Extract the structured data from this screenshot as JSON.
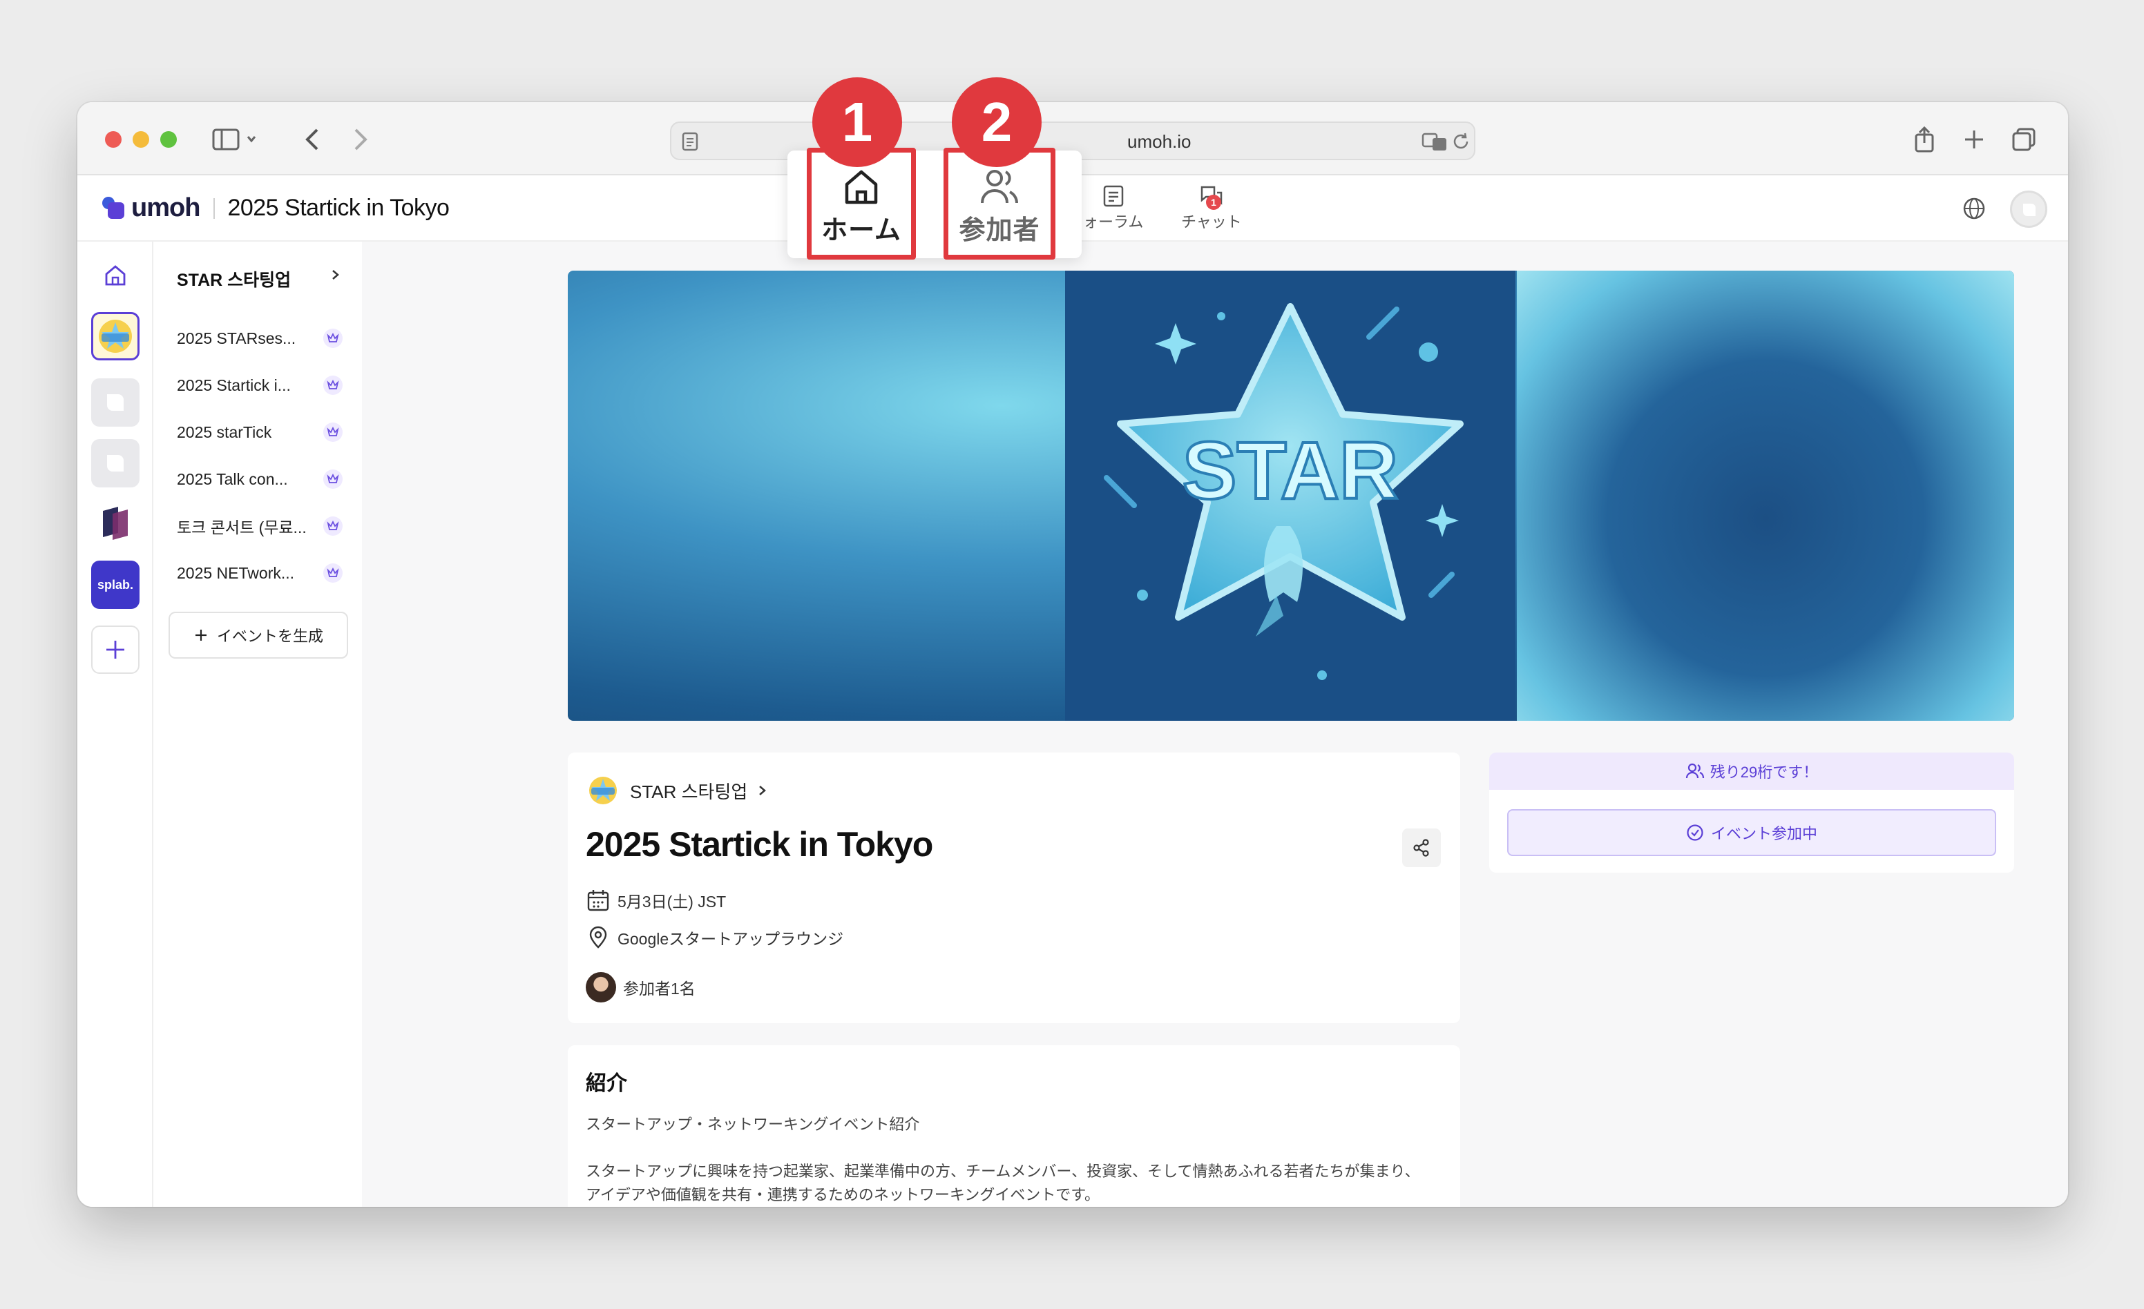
{
  "browser": {
    "url": "umoh.io"
  },
  "app": {
    "logo_text": "umoh",
    "event_title": "2025 Startick in Tokyo",
    "nav": {
      "forum_label": "ォーラム",
      "chat_label": "チャット",
      "chat_badge": "1"
    }
  },
  "annotations": {
    "home": {
      "number": "1",
      "label": "ホーム"
    },
    "participants": {
      "number": "2",
      "label": "参加者"
    }
  },
  "rail": {
    "splab_label": "splab."
  },
  "sidebar": {
    "header": "STAR 스타팅업",
    "items": [
      {
        "label": "2025 STARses..."
      },
      {
        "label": "2025 Startick i..."
      },
      {
        "label": "2025 starTick"
      },
      {
        "label": "2025 Talk con..."
      },
      {
        "label": "토크 콘서트 (무료..."
      },
      {
        "label": "2025 NETwork..."
      }
    ],
    "create_label": "イベントを生成"
  },
  "banner": {
    "star_text": "STAR"
  },
  "event": {
    "organizer": "STAR 스타팅업",
    "title": "2025 Startick in Tokyo",
    "date": "5月3日(土) JST",
    "location": "Googleスタートアップラウンジ",
    "participants": "参加者1名"
  },
  "registration": {
    "remaining": "残り29桁です！",
    "join_label": "イベント参加中"
  },
  "intro": {
    "heading": "紹介",
    "subtitle": "スタートアップ・ネットワーキングイベント紹介",
    "body_line1": "スタートアップに興味を持つ起業家、起業準備中の方、チームメンバー、投資家、そして情熱あふれる若者たちが集まり、",
    "body_line2": "アイデアや価値観を共有・連携するためのネットワーキングイベントです。"
  },
  "colors": {
    "accent": "#5b3fd6",
    "highlight": "#e0393e",
    "banner_dark": "#1a4f86"
  }
}
